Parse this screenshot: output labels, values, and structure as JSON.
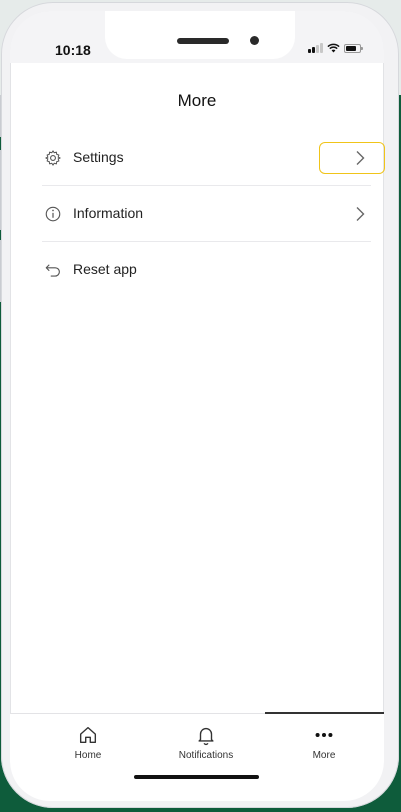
{
  "status": {
    "time": "10:18"
  },
  "header": {
    "title": "More"
  },
  "menu": {
    "items": [
      {
        "label": "Settings",
        "icon": "gear-icon",
        "has_chevron": true
      },
      {
        "label": "Information",
        "icon": "info-icon",
        "has_chevron": true
      },
      {
        "label": "Reset app",
        "icon": "undo-icon",
        "has_chevron": false
      }
    ]
  },
  "tabs": [
    {
      "label": "Home",
      "icon": "home-icon",
      "active": false
    },
    {
      "label": "Notifications",
      "icon": "bell-icon",
      "active": false
    },
    {
      "label": "More",
      "icon": "more-dots-icon",
      "active": true
    }
  ],
  "colors": {
    "background_green": "#0e5c3b",
    "highlight_yellow": "#f0c419",
    "text": "#222222"
  }
}
